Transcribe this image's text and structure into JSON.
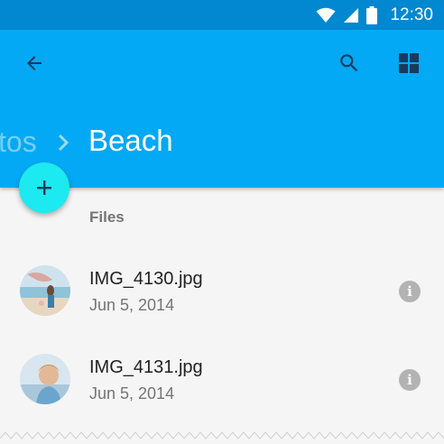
{
  "status_bar": {
    "time": "12:30",
    "icons": [
      "wifi-icon",
      "signal-icon",
      "battery-icon"
    ]
  },
  "toolbar": {
    "back_icon": "arrow-back-icon",
    "search_icon": "search-icon",
    "view_icon": "grid-view-icon"
  },
  "breadcrumb": {
    "previous": "tos",
    "current": "Beach"
  },
  "fab": {
    "icon": "add-icon"
  },
  "section": {
    "title": "Files"
  },
  "files": [
    {
      "name": "IMG_4130.jpg",
      "date": "Jun 5, 2014",
      "thumbnail": "beach-photo-thumbnail"
    },
    {
      "name": "IMG_4131.jpg",
      "date": "Jun 5, 2014",
      "thumbnail": "child-photo-thumbnail"
    }
  ],
  "colors": {
    "status_bar": "#0288d1",
    "app_bar": "#03a9f4",
    "fab": "#1de9f0",
    "background": "#f5f5f5"
  }
}
